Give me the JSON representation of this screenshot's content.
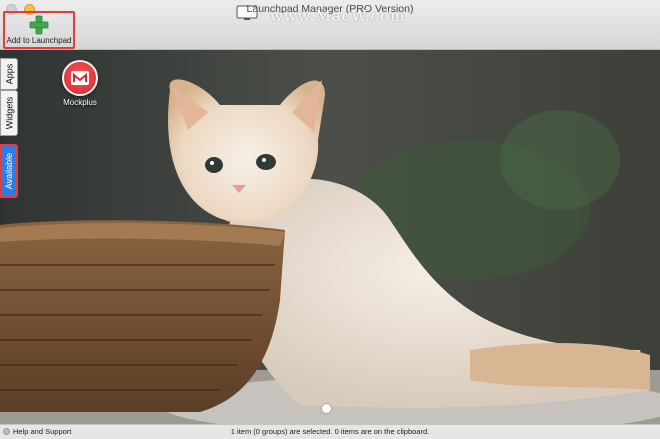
{
  "window": {
    "title": "Launchpad Manager (PRO Version)",
    "watermark": "www.MacW.com"
  },
  "toolbar": {
    "add_label": "Add to Launchpad"
  },
  "sidebar": {
    "tabs": [
      {
        "label": "Apps",
        "active": false
      },
      {
        "label": "Widgets",
        "active": false
      },
      {
        "label": "Available",
        "active": true
      }
    ]
  },
  "apps": [
    {
      "label": "Mockplus",
      "icon": "mockplus-icon"
    }
  ],
  "pagination": {
    "pages": 1,
    "current": 1
  },
  "status": {
    "help_label": "Help and Support",
    "message": "1 item (0 groups) are selected. 0 items are on the clipboard."
  },
  "colors": {
    "selection_outline": "#e43b3b",
    "active_tab": "#2f7de2",
    "add_icon": "#3fa84a",
    "app_icon": "#d6262c"
  }
}
